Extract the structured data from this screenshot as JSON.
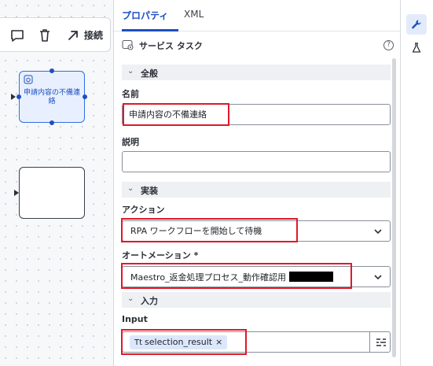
{
  "toolbar": {
    "connect_label": "接続",
    "icons": [
      "comment-icon",
      "trash-icon",
      "connect-arrow-icon"
    ]
  },
  "canvas": {
    "task_node_label": "申請内容の不備連絡"
  },
  "tabs": [
    {
      "label": "プロパティ",
      "active": true
    },
    {
      "label": "XML",
      "active": false
    }
  ],
  "panel": {
    "header_title": "サービス タスク",
    "help_label": "?"
  },
  "sections": {
    "general": "全般",
    "implementation": "実装",
    "input": "入力"
  },
  "fields": {
    "name_label": "名前",
    "name_value": "申請内容の不備連絡",
    "description_label": "説明",
    "description_value": "",
    "action_label": "アクション",
    "action_value": "RPA ワークフローを開始して待機",
    "automation_label": "オートメーション *",
    "automation_value": "Maestro_返金処理プロセス_動作確認用",
    "input_label": "Input",
    "input_chip_prefix": "Tt",
    "input_chip_value": "selection_result",
    "input_chip_remove": "×"
  },
  "colors": {
    "accent": "#1d4fbf",
    "highlight": "#e0182b"
  }
}
